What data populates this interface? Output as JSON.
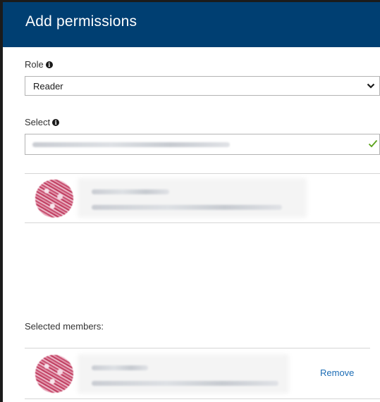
{
  "header": {
    "title": "Add permissions"
  },
  "role": {
    "label": "Role",
    "info_icon": "info-icon",
    "selected_value": "Reader",
    "dropdown_icon": "chevron-down-icon"
  },
  "select": {
    "label": "Select",
    "info_icon": "info-icon",
    "value_obscured": true,
    "valid_icon": "checkmark-icon"
  },
  "search_result": {
    "avatar_icon": "avatar",
    "name_obscured": true,
    "email_obscured": true
  },
  "selected_members": {
    "label": "Selected members:",
    "items": [
      {
        "name_obscured": true,
        "email_obscured": true,
        "remove_label": "Remove"
      }
    ]
  },
  "colors": {
    "header_bg": "#003f72",
    "link": "#1b6cb5",
    "check": "#5aa21a"
  }
}
